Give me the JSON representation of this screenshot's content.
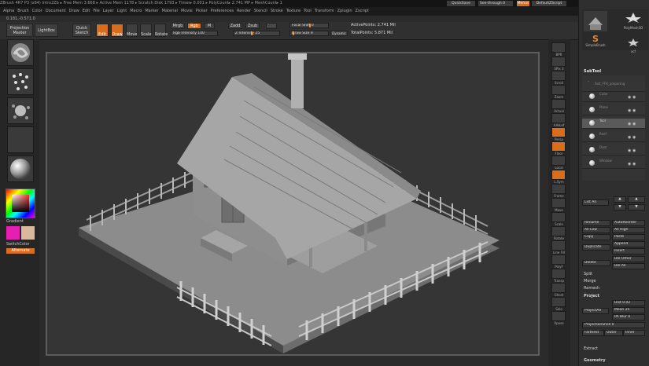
{
  "title_bar": {
    "text": "ZBrush 4R7 P3 (x64)    Intro2Zb    ▸ Free Mem 3.668    ▸ Active Mem 1178    ▸ Scratch Disk 1793    ▸ Timer▸ 0.001    ▸ PolyCount▸ 2.741 MP    ▸ MeshCount▸ 1"
  },
  "right_header": {
    "quicksave": "QuickSave",
    "see_through": "See-through 0",
    "menus": "Menus",
    "default_script": "DefaultZScript"
  },
  "menu_bar": [
    "Alpha",
    "Brush",
    "Color",
    "Document",
    "Draw",
    "Edit",
    "File",
    "Layer",
    "Light",
    "Macro",
    "Marker",
    "Material",
    "Movie",
    "Picker",
    "Preferences",
    "Render",
    "Stencil",
    "Stroke",
    "Texture",
    "Tool",
    "Transform",
    "Zplugin",
    "Zscript"
  ],
  "coordinates": "0.181,-0.571,0",
  "shelf": {
    "projection_master": "Projection Master",
    "lightbox": "LightBox",
    "quick_sketch": "Quick Sketch",
    "edit": "Edit",
    "draw": "Draw",
    "move": "Move",
    "scale": "Scale",
    "rotate": "Rotate",
    "mrgb": "Mrgb",
    "rgb": "Rgb",
    "m": "M",
    "rgb_intensity": "Rgb Intensity 100",
    "zadd": "Zadd",
    "zsub": "Zsub",
    "zcut": "Zcut",
    "z_intensity": "Z Intensity 25",
    "focal_shift": "Focal Shift 0",
    "draw_size": "Draw Size 9",
    "dynamic": "Dynamic",
    "active_points": "ActivePoints: 2.741 Mil",
    "total_points": "TotalPoints: 5.871 Mil"
  },
  "left_bar": {
    "gradient": "Gradient",
    "switch_color": "SwitchColor",
    "alternate": "Alternate"
  },
  "right_strip": [
    "BPR",
    "SPix 3",
    "Scroll",
    "Zoom",
    "Actual",
    "AAHalf",
    "Persp",
    "Floor",
    "Local",
    "L.Sym",
    "Frame",
    "Move",
    "Scale",
    "Rotate",
    "Line Fill",
    "PolyF",
    "Transp",
    "Ghost",
    "Solo",
    "Xpose"
  ],
  "panel": {
    "tool_thumbs": [
      "SimpleBrush",
      "PolyMesh3D",
      "Cylinder3D",
      "xcf"
    ],
    "subtool_header": "SubTool",
    "subtools": [
      "fast_FFX_preparing",
      "Cube",
      "Plane",
      "Tool",
      "Roof",
      "Door",
      "Window"
    ],
    "list_all": "List All",
    "rename": "Rename",
    "auto_reorder": "AutoReorder",
    "all_low": "All Low",
    "all_high": "All High",
    "copy": "Copy",
    "paste": "Paste",
    "duplicate": "Duplicate",
    "append": "Append",
    "insert": "Insert",
    "delete": "Delete",
    "del_other": "Del Other",
    "del_all": "Del All",
    "split": "Split",
    "merge": "Merge",
    "remesh": "Remesh",
    "project": "Project",
    "project_all": "ProjectAll",
    "dist": "Dist 0.02",
    "mean": "Mean 25",
    "pa_blur": "PA Blur 0",
    "projection_shell": "ProjectionShell 0",
    "farthest": "Farthest",
    "outer": "Outer",
    "inner": "Inner",
    "extract": "Extract",
    "geometry": "Geometry"
  },
  "colors": {
    "accent": "#d86d1e",
    "panel": "#2f2f2f",
    "canvas": "#353535"
  }
}
